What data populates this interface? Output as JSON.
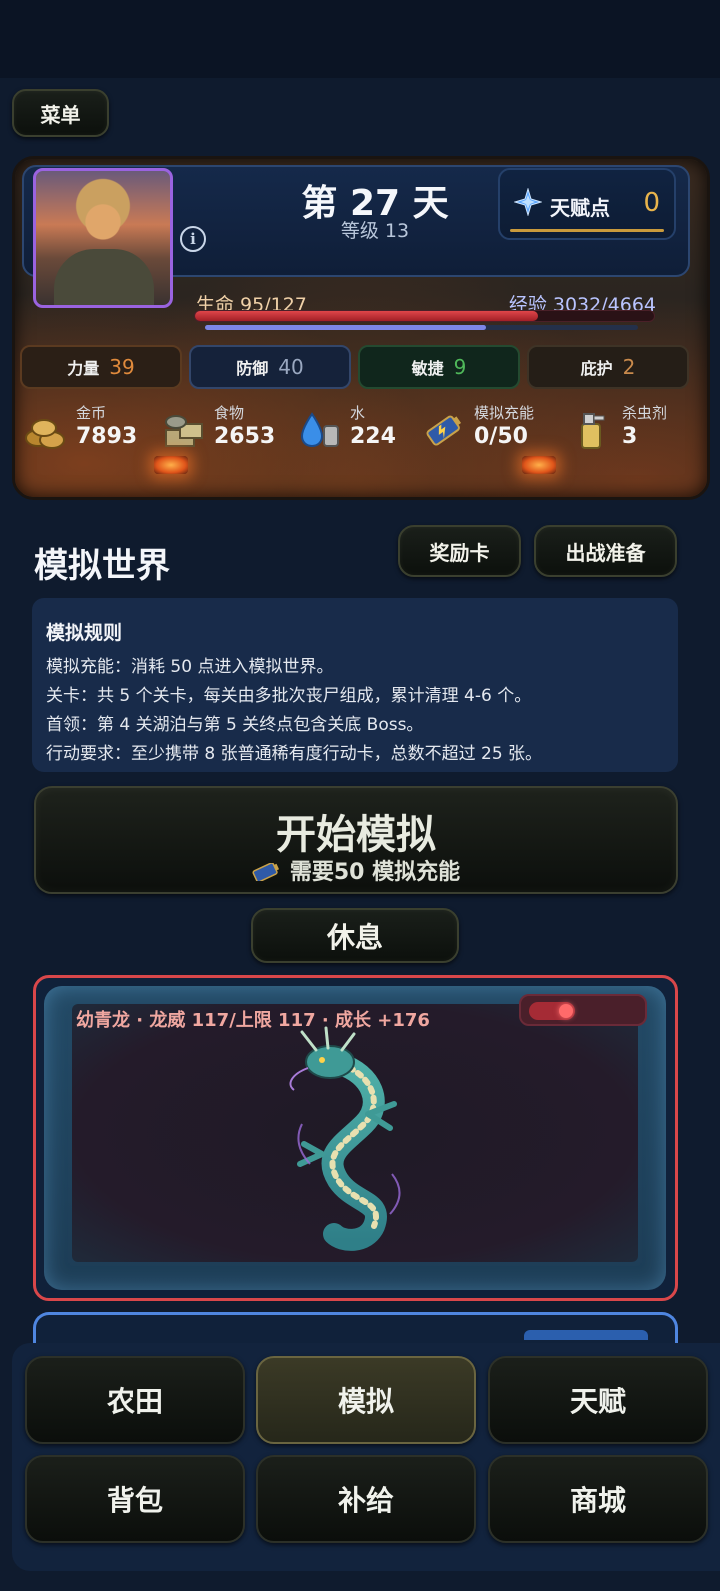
{
  "header": {
    "menu_label": "菜单"
  },
  "status": {
    "day_title": "第 27 天",
    "level": "等级 13",
    "info_symbol": "i",
    "talent": {
      "label": "天赋点",
      "value": "0"
    },
    "hp": {
      "label": "生命 95/127",
      "fraction": 0.748
    },
    "exp": {
      "label": "经验 3032/4664",
      "fraction": 0.65
    },
    "stats": [
      {
        "label": "力量",
        "value": "39",
        "color": "#e08a3c"
      },
      {
        "label": "防御",
        "value": "40",
        "color": "#9aa8c0"
      },
      {
        "label": "敏捷",
        "value": "9",
        "color": "#4fb85a"
      },
      {
        "label": "庇护",
        "value": "2",
        "color": "#c98a4c"
      }
    ],
    "resources": [
      {
        "icon": "coins-icon",
        "label": "金币",
        "value": "7893"
      },
      {
        "icon": "food-icon",
        "label": "食物",
        "value": "2653"
      },
      {
        "icon": "water-icon",
        "label": "水",
        "value": "224"
      },
      {
        "icon": "battery-icon",
        "label": "模拟充能",
        "value": "0/50"
      },
      {
        "icon": "spray-icon",
        "label": "杀虫剂",
        "value": "3"
      }
    ]
  },
  "world": {
    "title": "模拟世界",
    "reward_button": "奖励卡",
    "prepare_button": "出战准备",
    "rules": {
      "title": "模拟规则",
      "lines": [
        "模拟充能：消耗 50 点进入模拟世界。",
        "关卡：共 5 个关卡，每关由多批次丧尸组成，累计清理 4-6 个。",
        "首领：第 4 关湖泊与第 5 关终点包含关底 Boss。",
        "行动要求：至少携带 8 张普通稀有度行动卡，总数不超过 25 张。"
      ]
    },
    "start": {
      "main": "开始模拟",
      "sub": "需要50 模拟充能"
    },
    "rest_button": "休息"
  },
  "pet": {
    "info": "幼青龙 · 龙威 117/上限 117 · 成长 +176",
    "toggle_on": true
  },
  "nav": {
    "items": [
      {
        "label": "农田",
        "active": false
      },
      {
        "label": "模拟",
        "active": true
      },
      {
        "label": "天赋",
        "active": false
      },
      {
        "label": "背包",
        "active": false
      },
      {
        "label": "补给",
        "active": false
      },
      {
        "label": "商城",
        "active": false
      }
    ]
  }
}
